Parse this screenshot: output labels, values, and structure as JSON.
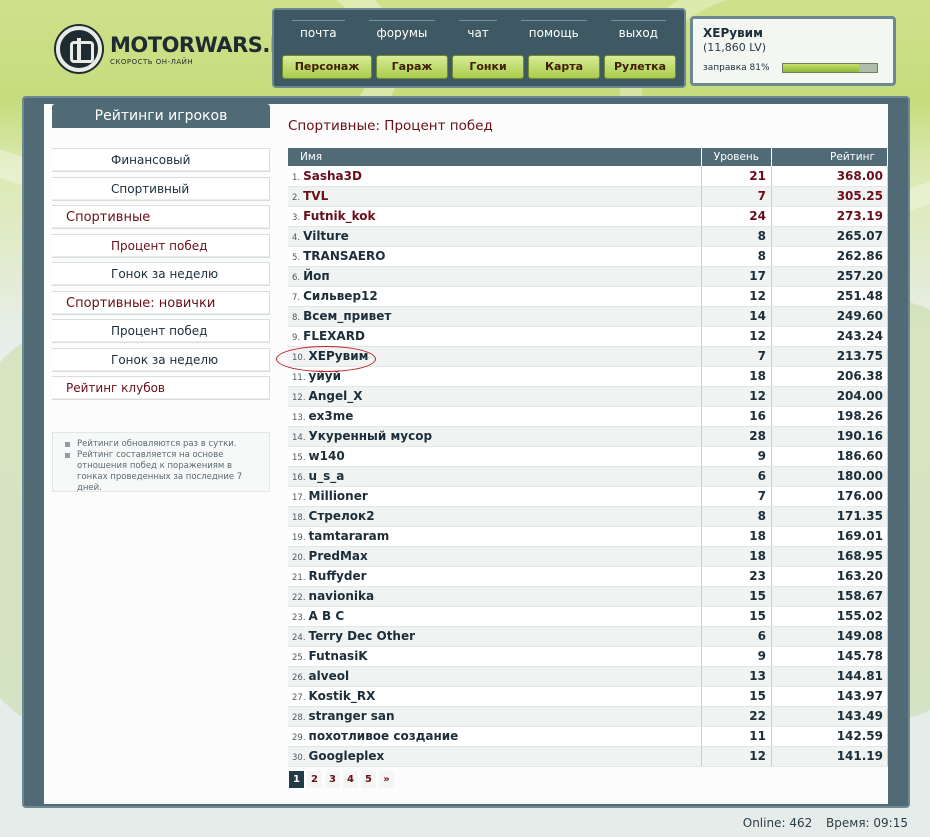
{
  "brand": {
    "name": "MOTORWARS.RU",
    "tagline": "СКОРОСТЬ ОН-ЛАЙН"
  },
  "topnav": {
    "links": [
      "почта",
      "форумы",
      "чат",
      "помощь",
      "выход"
    ],
    "buttons": [
      "Персонаж",
      "Гараж",
      "Гонки",
      "Карта",
      "Рулетка"
    ]
  },
  "user": {
    "name": "XEPувим",
    "level": "(11,860 LV)",
    "fuel_label": "заправка 81%",
    "fuel": 0.81
  },
  "sidebar": {
    "title": "Рейтинги игроков",
    "items": [
      "Финансовый",
      "Спортивный",
      "Спортивные",
      "Процент побед",
      "Гонок за неделю",
      "Спортивные: новички",
      "Процент побед",
      "Гонок за неделю",
      "Рейтинг клубов"
    ],
    "notes": [
      "Рейтинги обновляются раз в сутки.",
      "Рейтинг составляется на основе отношения побед к поражениям в гонках проведенных за последние 7 дней."
    ]
  },
  "page": {
    "title": "Спортивные: Процент побед"
  },
  "table": {
    "headers": [
      "Имя",
      "Уровень",
      "Рейтинг"
    ],
    "rows": [
      [
        "1.",
        "Sasha3D",
        "21",
        "368.00"
      ],
      [
        "2.",
        "TVL",
        "7",
        "305.25"
      ],
      [
        "3.",
        "Futnik_kok",
        "24",
        "273.19"
      ],
      [
        "4.",
        "Vilture",
        "8",
        "265.07"
      ],
      [
        "5.",
        "TRANSAERO",
        "8",
        "262.86"
      ],
      [
        "6.",
        "Йоп",
        "17",
        "257.20"
      ],
      [
        "7.",
        "Сильвер12",
        "12",
        "251.48"
      ],
      [
        "8.",
        "Всем_привет",
        "14",
        "249.60"
      ],
      [
        "9.",
        "FLEXARD",
        "12",
        "243.24"
      ],
      [
        "10.",
        "XEPувим",
        "7",
        "213.75"
      ],
      [
        "11.",
        "уйуй",
        "18",
        "206.38"
      ],
      [
        "12.",
        "Angel_X",
        "12",
        "204.00"
      ],
      [
        "13.",
        "ex3me",
        "16",
        "198.26"
      ],
      [
        "14.",
        "Укуренный мусор",
        "28",
        "190.16"
      ],
      [
        "15.",
        "w140",
        "9",
        "186.60"
      ],
      [
        "16.",
        "u_s_a",
        "6",
        "180.00"
      ],
      [
        "17.",
        "Millioner",
        "7",
        "176.00"
      ],
      [
        "18.",
        "Стрелок2",
        "8",
        "171.35"
      ],
      [
        "19.",
        "tamtararam",
        "18",
        "169.01"
      ],
      [
        "20.",
        "PredMax",
        "18",
        "168.95"
      ],
      [
        "21.",
        "Ruffyder",
        "23",
        "163.20"
      ],
      [
        "22.",
        "navionika",
        "15",
        "158.67"
      ],
      [
        "23.",
        "A B C",
        "15",
        "155.02"
      ],
      [
        "24.",
        "Terry Dec Other",
        "6",
        "149.08"
      ],
      [
        "25.",
        "FutnasiK",
        "9",
        "145.78"
      ],
      [
        "26.",
        "alveol",
        "13",
        "144.81"
      ],
      [
        "27.",
        "Kostik_RX",
        "15",
        "143.97"
      ],
      [
        "28.",
        "stranger san",
        "22",
        "143.49"
      ],
      [
        "29.",
        "похотливое создание",
        "11",
        "142.59"
      ],
      [
        "30.",
        "Googleplex",
        "12",
        "141.19"
      ]
    ]
  },
  "pager": [
    "1",
    "2",
    "3",
    "4",
    "5",
    "»"
  ],
  "status": {
    "online": "Online: 462",
    "time": "Время: 09:15"
  }
}
